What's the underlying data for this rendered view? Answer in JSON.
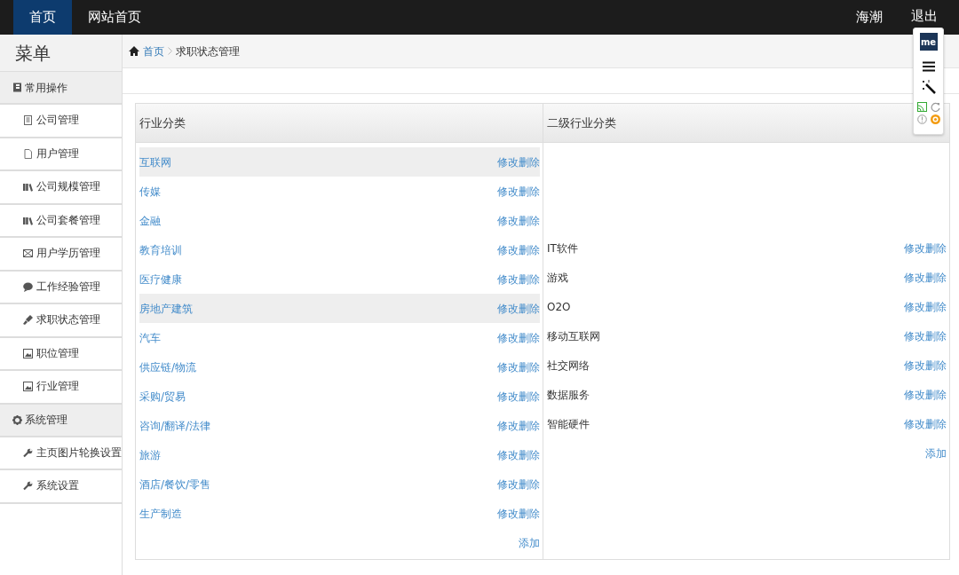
{
  "navbar": {
    "tabs": [
      {
        "label": "首页",
        "selected": true
      },
      {
        "label": "网站首页",
        "selected": false
      }
    ],
    "user": "海潮",
    "logout": "退出"
  },
  "extension_toolbar": {
    "logo": "me"
  },
  "sidebar": {
    "title": "菜单",
    "groups": [
      {
        "label": "常用操作",
        "items": [
          {
            "label": "公司管理"
          },
          {
            "label": "用户管理"
          },
          {
            "label": "公司规模管理"
          },
          {
            "label": "公司套餐管理"
          },
          {
            "label": "用户学历管理"
          },
          {
            "label": "工作经验管理"
          },
          {
            "label": "求职状态管理"
          },
          {
            "label": "职位管理"
          },
          {
            "label": "行业管理"
          }
        ]
      },
      {
        "label": "系统管理",
        "items": [
          {
            "label": "主页图片轮换设置"
          },
          {
            "label": "系统设置"
          }
        ]
      }
    ]
  },
  "breadcrumb": [
    "首页",
    "求职状态管理"
  ],
  "panel": {
    "columns": [
      "行业分类",
      "二级行业分类"
    ],
    "categories": [
      {
        "name": "互联网",
        "selected": true,
        "action": "修改删除"
      },
      {
        "name": "传媒",
        "selected": false,
        "action": "修改删除"
      },
      {
        "name": "金融",
        "selected": false,
        "action": "修改删除"
      },
      {
        "name": "教育培训",
        "selected": false,
        "action": "修改删除"
      },
      {
        "name": "医疗健康",
        "selected": false,
        "action": "修改删除"
      },
      {
        "name": "房地产建筑",
        "selected": true,
        "action": "修改删除"
      },
      {
        "name": "汽车",
        "selected": false,
        "action": "修改删除"
      },
      {
        "name": "供应链/物流",
        "selected": false,
        "action": "修改删除"
      },
      {
        "name": "采购/贸易",
        "selected": false,
        "action": "修改删除"
      },
      {
        "name": "咨询/翻译/法律",
        "selected": false,
        "action": "修改删除"
      },
      {
        "name": "旅游",
        "selected": false,
        "action": "修改删除"
      },
      {
        "name": "酒店/餐饮/零售",
        "selected": false,
        "action": "修改删除"
      },
      {
        "name": "生产制造",
        "selected": false,
        "action": "修改删除"
      }
    ],
    "add_category": "添加",
    "subcategories": [
      {
        "name": "IT软件",
        "action": "修改删除"
      },
      {
        "name": "游戏",
        "action": "修改删除"
      },
      {
        "name": "O2O",
        "action": "修改删除"
      },
      {
        "name": "移动互联网",
        "action": "修改删除"
      },
      {
        "name": "社交网络",
        "action": "修改删除"
      },
      {
        "name": "数据服务",
        "action": "修改删除"
      },
      {
        "name": "智能硬件",
        "action": "修改删除"
      }
    ],
    "add_subcategory": "添加"
  }
}
